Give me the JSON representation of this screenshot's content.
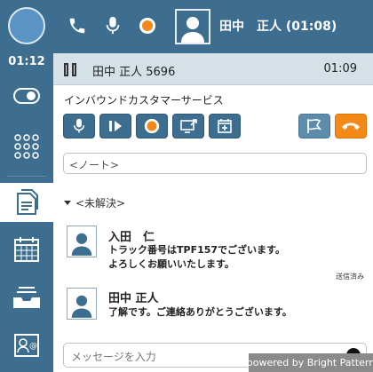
{
  "topbar": {
    "contact_name": "田中　正人",
    "call_timer": "(01:08)"
  },
  "sidebar": {
    "session_timer": "01:12",
    "items": [
      {
        "name": "toggle-switch-icon"
      },
      {
        "name": "dialpad-icon"
      },
      {
        "name": "document-icon",
        "active": true
      },
      {
        "name": "calendar-icon"
      },
      {
        "name": "inbox-icon"
      },
      {
        "name": "contact-card-icon"
      }
    ]
  },
  "call": {
    "title": "田中 正人 5696",
    "duration": "01:09",
    "service": "インバウンドカスタマーサービス"
  },
  "toolbar": {
    "buttons": [
      "microphone-icon",
      "play-pause-icon",
      "record-icon",
      "screen-share-icon",
      "schedule-icon",
      "flag-icon",
      "hangup-icon"
    ]
  },
  "notes": {
    "placeholder": "<ノート>"
  },
  "disposition": {
    "label": "<未解決>"
  },
  "messages": [
    {
      "name": "入田　仁",
      "lines": [
        "トラック番号はTPF157でございます。",
        "よろしくお願いいたします。"
      ],
      "status": "送信済み"
    },
    {
      "name": "田中 正人",
      "lines": [
        "了解です。ご連絡ありがとうございます。"
      ]
    }
  ],
  "composer": {
    "placeholder": "メッセージを入力"
  },
  "footer": {
    "powered_by": "powered by Bright Pattern"
  },
  "colors": {
    "brand": "#3d6e8f",
    "accent": "#f38a17",
    "header": "#d5e0e7"
  }
}
